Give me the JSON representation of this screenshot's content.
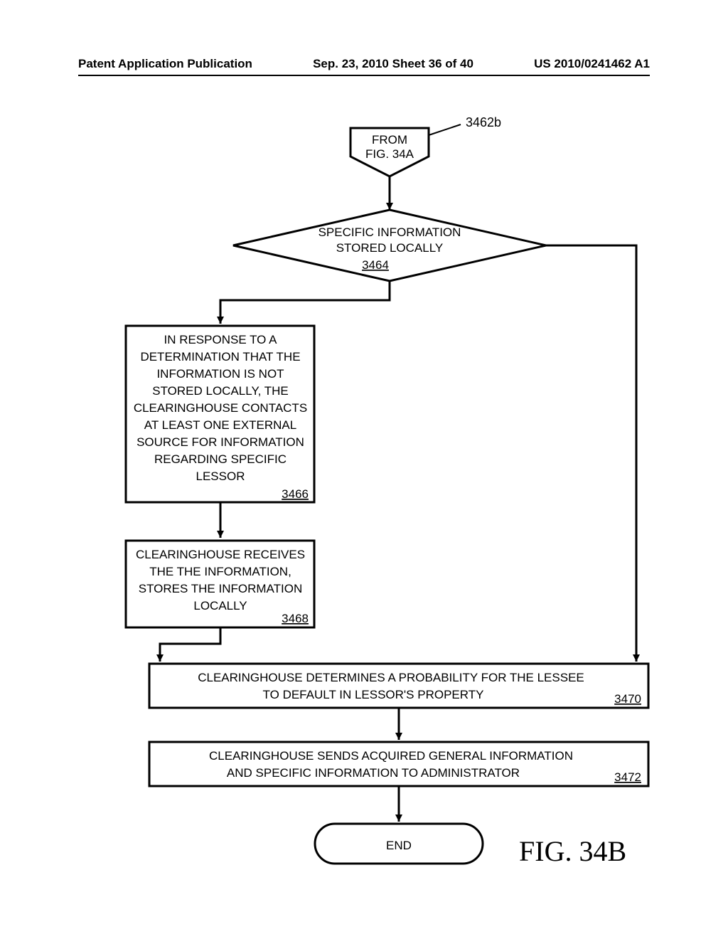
{
  "header": {
    "left": "Patent Application Publication",
    "center": "Sep. 23, 2010  Sheet 36 of 40",
    "right": "US 2010/0241462 A1"
  },
  "connector": {
    "line1": "FROM",
    "line2": "FIG. 34A",
    "ref": "3462b"
  },
  "decision": {
    "line1": "SPECIFIC INFORMATION",
    "line2": "STORED LOCALLY",
    "ref": "3464"
  },
  "box3466": {
    "l1": "IN RESPONSE TO A",
    "l2": "DETERMINATION THAT THE",
    "l3": "INFORMATION IS NOT",
    "l4": "STORED LOCALLY, THE",
    "l5": "CLEARINGHOUSE CONTACTS",
    "l6": "AT LEAST ONE EXTERNAL",
    "l7": "SOURCE FOR INFORMATION",
    "l8": "REGARDING SPECIFIC",
    "l9": "LESSOR",
    "ref": "3466"
  },
  "box3468": {
    "l1": "CLEARINGHOUSE RECEIVES",
    "l2": "THE THE INFORMATION,",
    "l3": "STORES THE INFORMATION",
    "l4": "LOCALLY",
    "ref": "3468"
  },
  "box3470": {
    "l1": "CLEARINGHOUSE DETERMINES A PROBABILITY FOR THE LESSEE",
    "l2": "TO DEFAULT IN LESSOR'S PROPERTY",
    "ref": "3470"
  },
  "box3472": {
    "l1": "CLEARINGHOUSE SENDS ACQUIRED GENERAL INFORMATION",
    "l2": "AND SPECIFIC INFORMATION TO ADMINISTRATOR",
    "ref": "3472"
  },
  "end": "END",
  "figlabel": "FIG. 34B"
}
